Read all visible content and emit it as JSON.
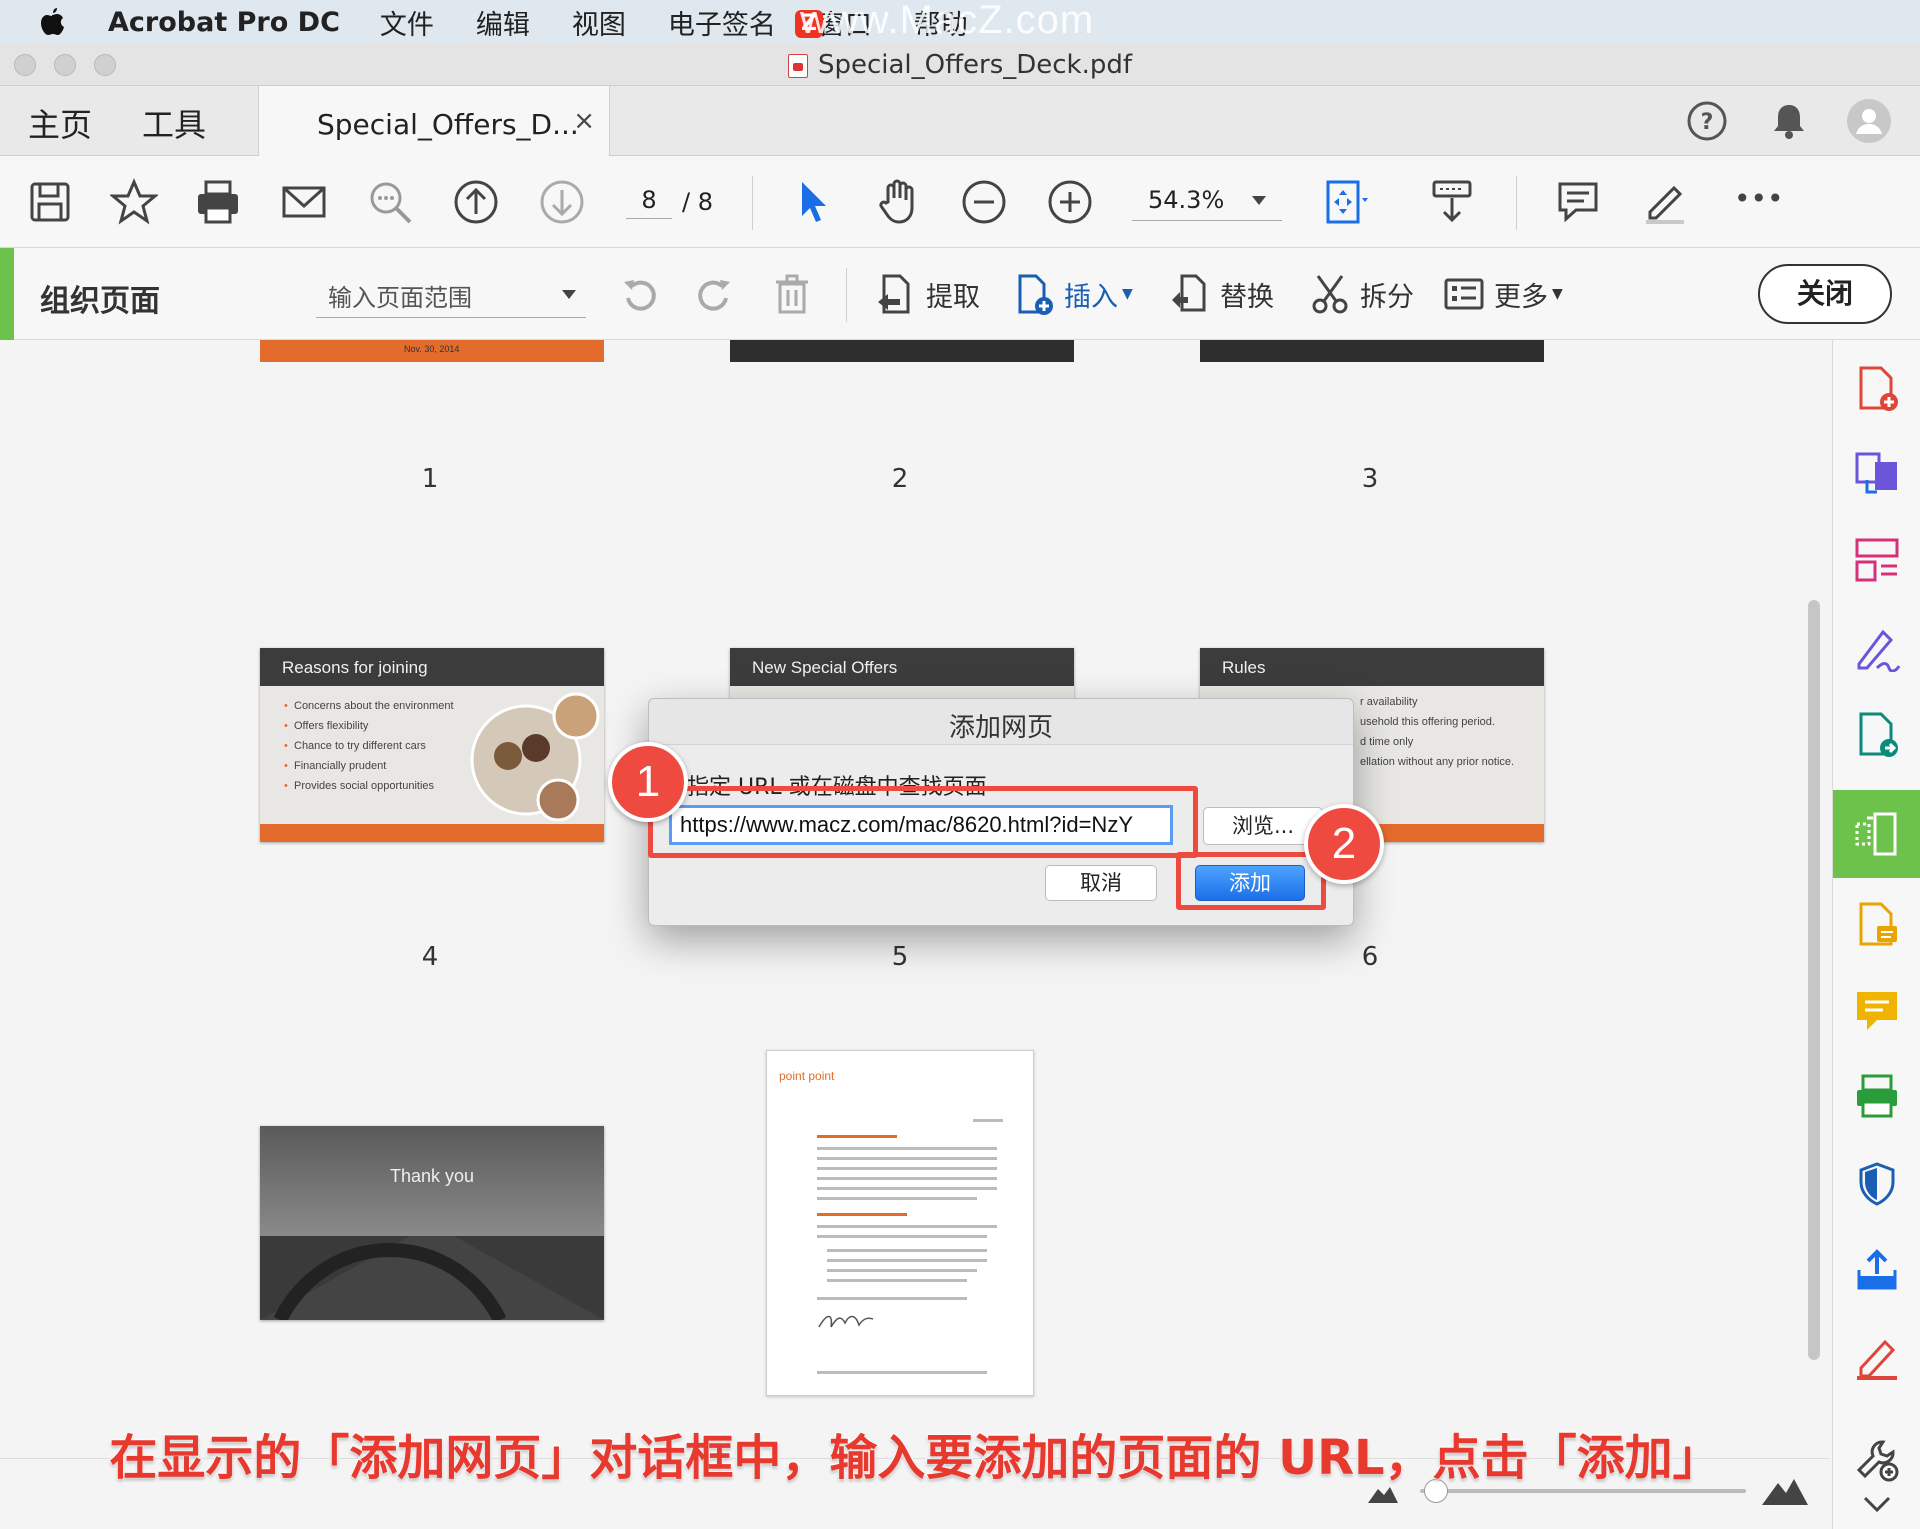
{
  "menubar": {
    "app_name": "Acrobat Pro DC",
    "items": [
      "文件",
      "编辑",
      "视图",
      "电子签名",
      "窗口",
      "帮助"
    ],
    "watermark": "www.MacZ.com"
  },
  "window": {
    "title": "Special_Offers_Deck.pdf"
  },
  "tabs": {
    "home": "主页",
    "tools": "工具",
    "document": "Special_Offers_D...",
    "close": "×"
  },
  "toolbar": {
    "page_current": "8",
    "page_total": "/ 8",
    "zoom": "54.3%",
    "more": "•••"
  },
  "organize": {
    "title": "组织页面",
    "range_placeholder": "输入页面范围",
    "extract": "提取",
    "insert": "插入",
    "replace": "替换",
    "split": "拆分",
    "more": "更多",
    "close": "关闭"
  },
  "pages": {
    "labels": [
      "1",
      "2",
      "3",
      "4",
      "5",
      "6"
    ],
    "p1_date": "Nov. 30, 2014",
    "p4": {
      "title": "Reasons for joining",
      "bullets": [
        "Concerns about the environment",
        "Offers flexibility",
        "Chance to try different cars",
        "Financially prudent",
        "Provides social opportunities"
      ]
    },
    "p5": {
      "title": "New Special Offers"
    },
    "p6": {
      "title": "Rules",
      "lines": [
        "r availability",
        "usehold this offering period.",
        "d time only",
        "ellation without any prior notice."
      ]
    },
    "p7": {
      "text": "Thank you"
    },
    "p8": {
      "logo": "point point"
    }
  },
  "dialog": {
    "title": "添加网页",
    "prompt": "指定 URL 或在磁盘中查找页面",
    "url_value": "https://www.macz.com/mac/8620.html?id=NzY",
    "browse": "浏览...",
    "cancel": "取消",
    "add": "添加"
  },
  "badges": {
    "one": "1",
    "two": "2"
  },
  "caption": "在显示的「添加网页」对话框中，输入要添加的页面的 URL，点击「添加」",
  "colors": {
    "accent_green": "#6cc24a",
    "highlight_red": "#ef4a40",
    "slide_orange": "#e36b2c",
    "button_blue": "#1a6fe8"
  }
}
